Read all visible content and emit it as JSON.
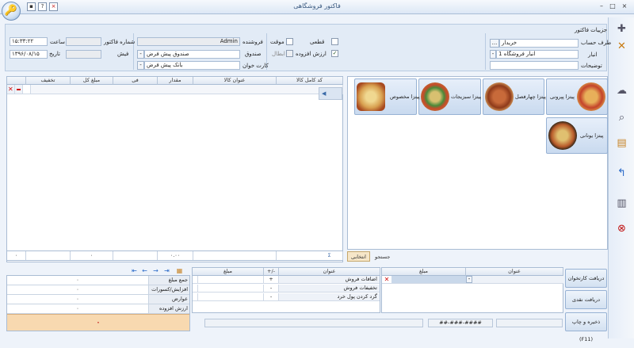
{
  "window": {
    "title": "فاکتور فروشگاهی"
  },
  "header": {
    "section_title": "جزییات فاکتور",
    "account_side_label": "طرف حساب",
    "account_side_value": "خریدار",
    "warehouse_label": "انبار",
    "warehouse_value": "انبار فروشگاه 1",
    "description_label": "توضیحات",
    "description_value": "",
    "final_label": "قطعی",
    "temp_label": "موقت",
    "vat_label": "ارزش افزوده",
    "cancel_label": "ابطال",
    "seller_label": "فروشنده",
    "seller_value": "Admin",
    "fund_label": "صندوق",
    "fund_value": "صندوق پیش فرض",
    "card_reader_label": "کارت خوان",
    "card_reader_value": "بانک پیش فرض",
    "invoice_no_label": "شماره فاکتور",
    "invoice_no_value": "",
    "receipt_label": "فیش",
    "receipt_value": "",
    "time_label": "ساعت",
    "time_value": "۱۵:۳۳:۲۲",
    "date_label": "تاریخ",
    "date_value": "۱۳۹۶/۰۸/۱۵",
    "ellipsis": "...",
    "minus": "-"
  },
  "grid": {
    "columns": [
      "کد کامل کالا",
      "عنوان کالا",
      "مقدار",
      "فی",
      "مبلغ کل",
      "تخفیف"
    ],
    "totals": [
      "Σ",
      "",
      "۰.۰۰",
      "",
      "۰",
      "",
      "۰"
    ]
  },
  "products": [
    {
      "name": "پیتزا پپرونی"
    },
    {
      "name": "پیتزا چهارفصل"
    },
    {
      "name": "پیتزا سبزیجات"
    },
    {
      "name": "پیتزا مخصوص"
    },
    {
      "name": "پیتزا یونانی"
    }
  ],
  "tabs": {
    "favorites": "انتخابی",
    "search": "جستجو"
  },
  "adjustments": {
    "columns": [
      "عنوان",
      "+/-",
      "مبلغ"
    ],
    "rows": [
      {
        "title": "اضافات فروش",
        "sign": "+"
      },
      {
        "title": "تخفیفات فروش",
        "sign": "-"
      },
      {
        "title": "گرد کردن پول خرد",
        "sign": "-"
      }
    ]
  },
  "payments": {
    "columns": [
      "عنوان",
      "مبلغ"
    ]
  },
  "summary": {
    "rows": [
      {
        "label": "جمع مبلغ",
        "value": "۰"
      },
      {
        "label": "افزایش/کسورات",
        "value": "۰"
      },
      {
        "label": "عوارض",
        "value": "۰"
      },
      {
        "label": "ارزش افزوده",
        "value": "۰"
      }
    ],
    "total": "۰"
  },
  "side_buttons": {
    "card": "دریافت کارتخوان",
    "cash": "دریافت نقدی",
    "save_print": "ذخیره و چاپ (F11)"
  },
  "status": {
    "mask": "##-###-####"
  },
  "colors": {
    "accent": "#f8d9b0",
    "delete": "#d01010"
  }
}
